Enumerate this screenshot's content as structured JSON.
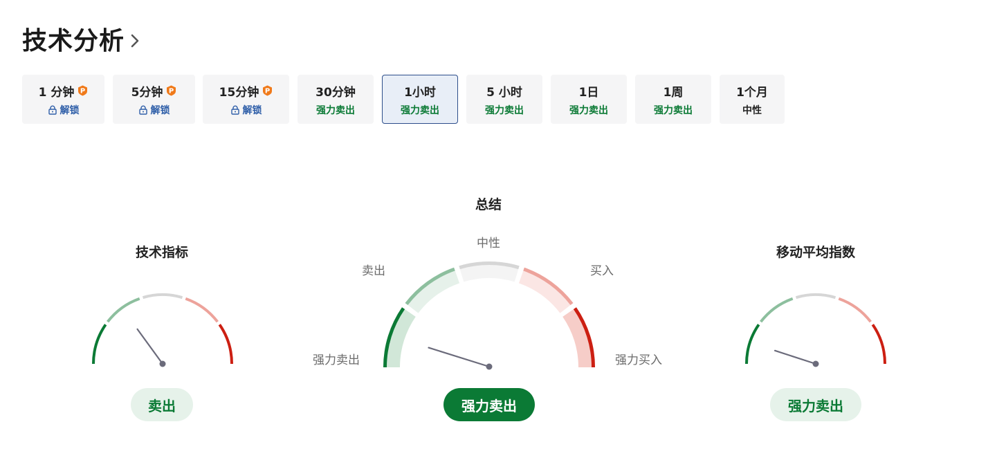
{
  "header": {
    "title": "技术分析"
  },
  "tabs": [
    {
      "label": "1 分钟",
      "status": "解锁",
      "locked": true,
      "pro": true,
      "tone": "locked"
    },
    {
      "label": "5分钟",
      "status": "解锁",
      "locked": true,
      "pro": true,
      "tone": "locked"
    },
    {
      "label": "15分钟",
      "status": "解锁",
      "locked": true,
      "pro": true,
      "tone": "locked"
    },
    {
      "label": "30分钟",
      "status": "强力卖出",
      "locked": false,
      "pro": false,
      "tone": "sell"
    },
    {
      "label": "1小时",
      "status": "强力卖出",
      "locked": false,
      "pro": false,
      "tone": "sell",
      "active": true
    },
    {
      "label": "5 小时",
      "status": "强力卖出",
      "locked": false,
      "pro": false,
      "tone": "sell"
    },
    {
      "label": "1日",
      "status": "强力卖出",
      "locked": false,
      "pro": false,
      "tone": "sell"
    },
    {
      "label": "1周",
      "status": "强力卖出",
      "locked": false,
      "pro": false,
      "tone": "sell"
    },
    {
      "label": "1个月",
      "status": "中性",
      "locked": false,
      "pro": false,
      "tone": "neutral"
    }
  ],
  "gauges": {
    "indicators": {
      "title": "技术指标",
      "result": "卖出",
      "needle_fraction": 0.3
    },
    "summary": {
      "title": "总结",
      "result": "强力卖出",
      "needle_fraction": 0.1,
      "labels": {
        "strong_sell": "强力卖出",
        "sell": "卖出",
        "neutral": "中性",
        "buy": "买入",
        "strong_buy": "强力买入"
      }
    },
    "moving_averages": {
      "title": "移动平均指数",
      "result": "强力卖出",
      "needle_fraction": 0.1
    }
  },
  "colors": {
    "strong_sell": "#0b7a35",
    "sell": "#8dbf9e",
    "neutral": "#d6d6d6",
    "buy": "#eda39b",
    "strong_buy": "#cc1f12",
    "needle": "#6b6b7b",
    "accent_blue": "#2c4d8a",
    "pro_orange": "#f07a1a"
  }
}
